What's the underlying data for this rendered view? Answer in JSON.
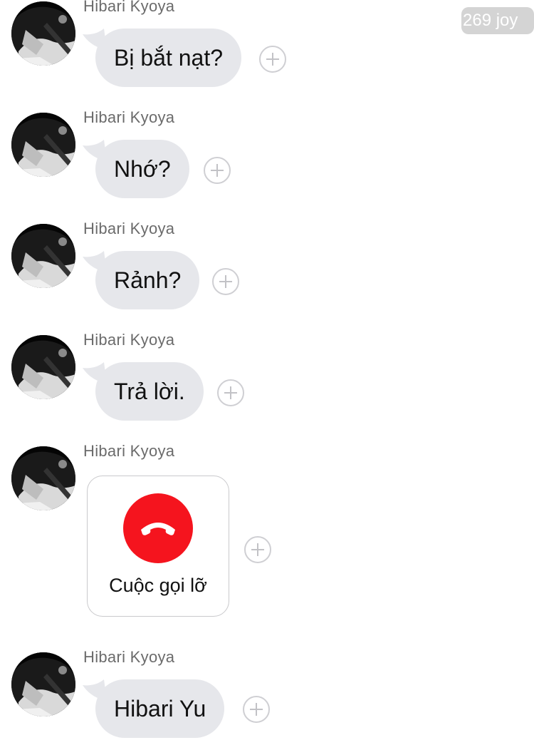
{
  "watermark": "269 joy",
  "messages": [
    {
      "sender": "Hibari Kyoya",
      "text": "Bị bắt nạt?"
    },
    {
      "sender": "Hibari Kyoya",
      "text": "Nhớ?"
    },
    {
      "sender": "Hibari Kyoya",
      "text": "Rảnh?"
    },
    {
      "sender": "Hibari Kyoya",
      "text": "Trả lời."
    },
    {
      "sender": "Hibari Kyoya",
      "call_label": "Cuộc gọi lỡ",
      "call_icon": "missed-call-phone-icon",
      "call_color": "#f5141e"
    },
    {
      "sender": "Hibari Kyoya",
      "text": "Hibari Yu"
    }
  ],
  "colors": {
    "bubble": "#e6e7eb",
    "sender_text": "#6b6b6b",
    "missed_call": "#f5141e"
  }
}
